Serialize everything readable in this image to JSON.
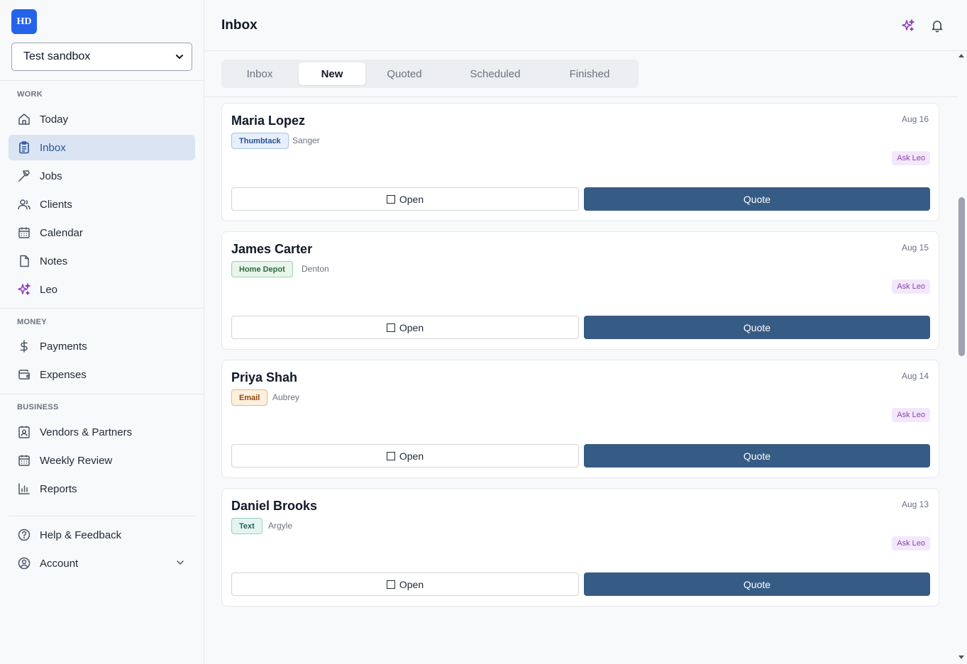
{
  "sidebar": {
    "logo_text": "HD",
    "org_select": {
      "value": "Test sandbox",
      "options": [
        "Test sandbox"
      ]
    },
    "sections": {
      "work": "WORK",
      "money": "MONEY",
      "business": "BUSINESS"
    },
    "items": [
      {
        "label": "Today",
        "icon": "home-icon"
      },
      {
        "label": "Inbox",
        "icon": "clipboard-icon",
        "active": true
      },
      {
        "label": "Jobs",
        "icon": "hammer-icon"
      },
      {
        "label": "Clients",
        "icon": "users-icon"
      },
      {
        "label": "Calendar",
        "icon": "calendar-icon"
      },
      {
        "label": "Notes",
        "icon": "file-icon"
      },
      {
        "label": "Leo",
        "icon": "sparkles-icon"
      },
      {
        "label": "Payments",
        "icon": "dollar-icon"
      },
      {
        "label": "Expenses",
        "icon": "wallet-icon"
      },
      {
        "label": "Vendors & Partners",
        "icon": "contact-icon"
      },
      {
        "label": "Weekly Review",
        "icon": "calendar-icon"
      },
      {
        "label": "Reports",
        "icon": "bar-chart-icon"
      },
      {
        "label": "Help & Feedback",
        "icon": "help-circle-icon"
      },
      {
        "label": "Account",
        "icon": "user-circle-icon"
      }
    ]
  },
  "header": {
    "title": "Inbox",
    "icons": [
      "sparkles-icon",
      "bell-icon"
    ]
  },
  "tabs": [
    {
      "label": "Inbox"
    },
    {
      "label": "New",
      "active": true
    },
    {
      "label": "Quoted"
    },
    {
      "label": "Scheduled"
    },
    {
      "label": "Finished"
    }
  ],
  "cards": [
    {
      "name": "Maria Lopez",
      "date": "Aug 16",
      "source": "Thumbtack",
      "city": "Sanger",
      "ask": "Ask Leo",
      "open": "Open",
      "quote": "Quote"
    },
    {
      "name": "James Carter",
      "date": "Aug 15",
      "source": "Home Depot",
      "city": "Denton",
      "ask": "Ask Leo",
      "open": "Open",
      "quote": "Quote"
    },
    {
      "name": "Priya Shah",
      "date": "Aug 14",
      "source": "Email",
      "city": "Aubrey",
      "ask": "Ask Leo",
      "open": "Open",
      "quote": "Quote"
    },
    {
      "name": "Daniel Brooks",
      "date": "Aug 13",
      "source": "Text",
      "city": "Argyle",
      "ask": "Ask Leo",
      "open": "Open",
      "quote": "Quote"
    }
  ],
  "colors": {
    "accent": "#2563eb",
    "active_nav_bg": "#dbe4f3",
    "quote_button": "#365c85",
    "leo_purple": "#8b3fb5"
  }
}
